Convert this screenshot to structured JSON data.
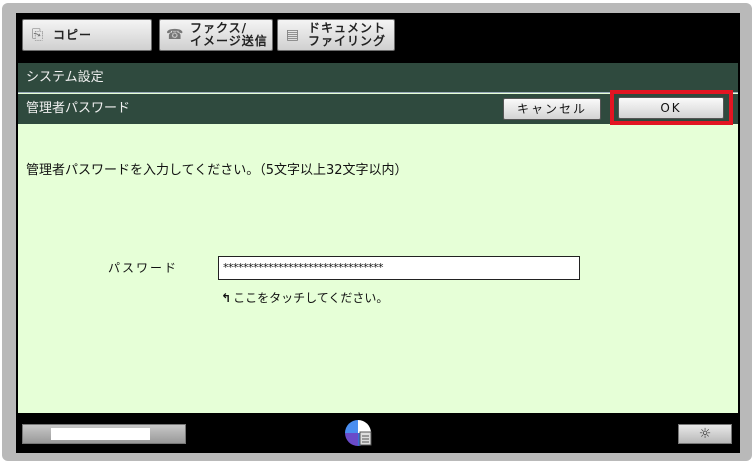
{
  "tabs": [
    {
      "label": "コピー",
      "icon": "copy-icon"
    },
    {
      "label": "ファクス/\nイメージ送信",
      "icon": "fax-icon"
    },
    {
      "label": "ドキュメント\nファイリング",
      "icon": "document-filing-icon"
    }
  ],
  "header": {
    "title": "システム設定",
    "subtitle": "管理者パスワード"
  },
  "buttons": {
    "cancel": "キャンセル",
    "ok": "OK"
  },
  "main": {
    "instruction": "管理者パスワードを入力してください。（5文字以上32文字以内）",
    "password_label": "パスワード",
    "password_value": "********************************",
    "hint": "ここをタッチしてください。"
  },
  "colors": {
    "header_bg": "#2f4a3e",
    "panel_bg": "#e6ffd7",
    "highlight": "#e21522"
  },
  "bottom": {
    "job_status_icon": "job-status-icon",
    "brightness_icon": "brightness-icon",
    "progress_fraction": 0.6
  }
}
